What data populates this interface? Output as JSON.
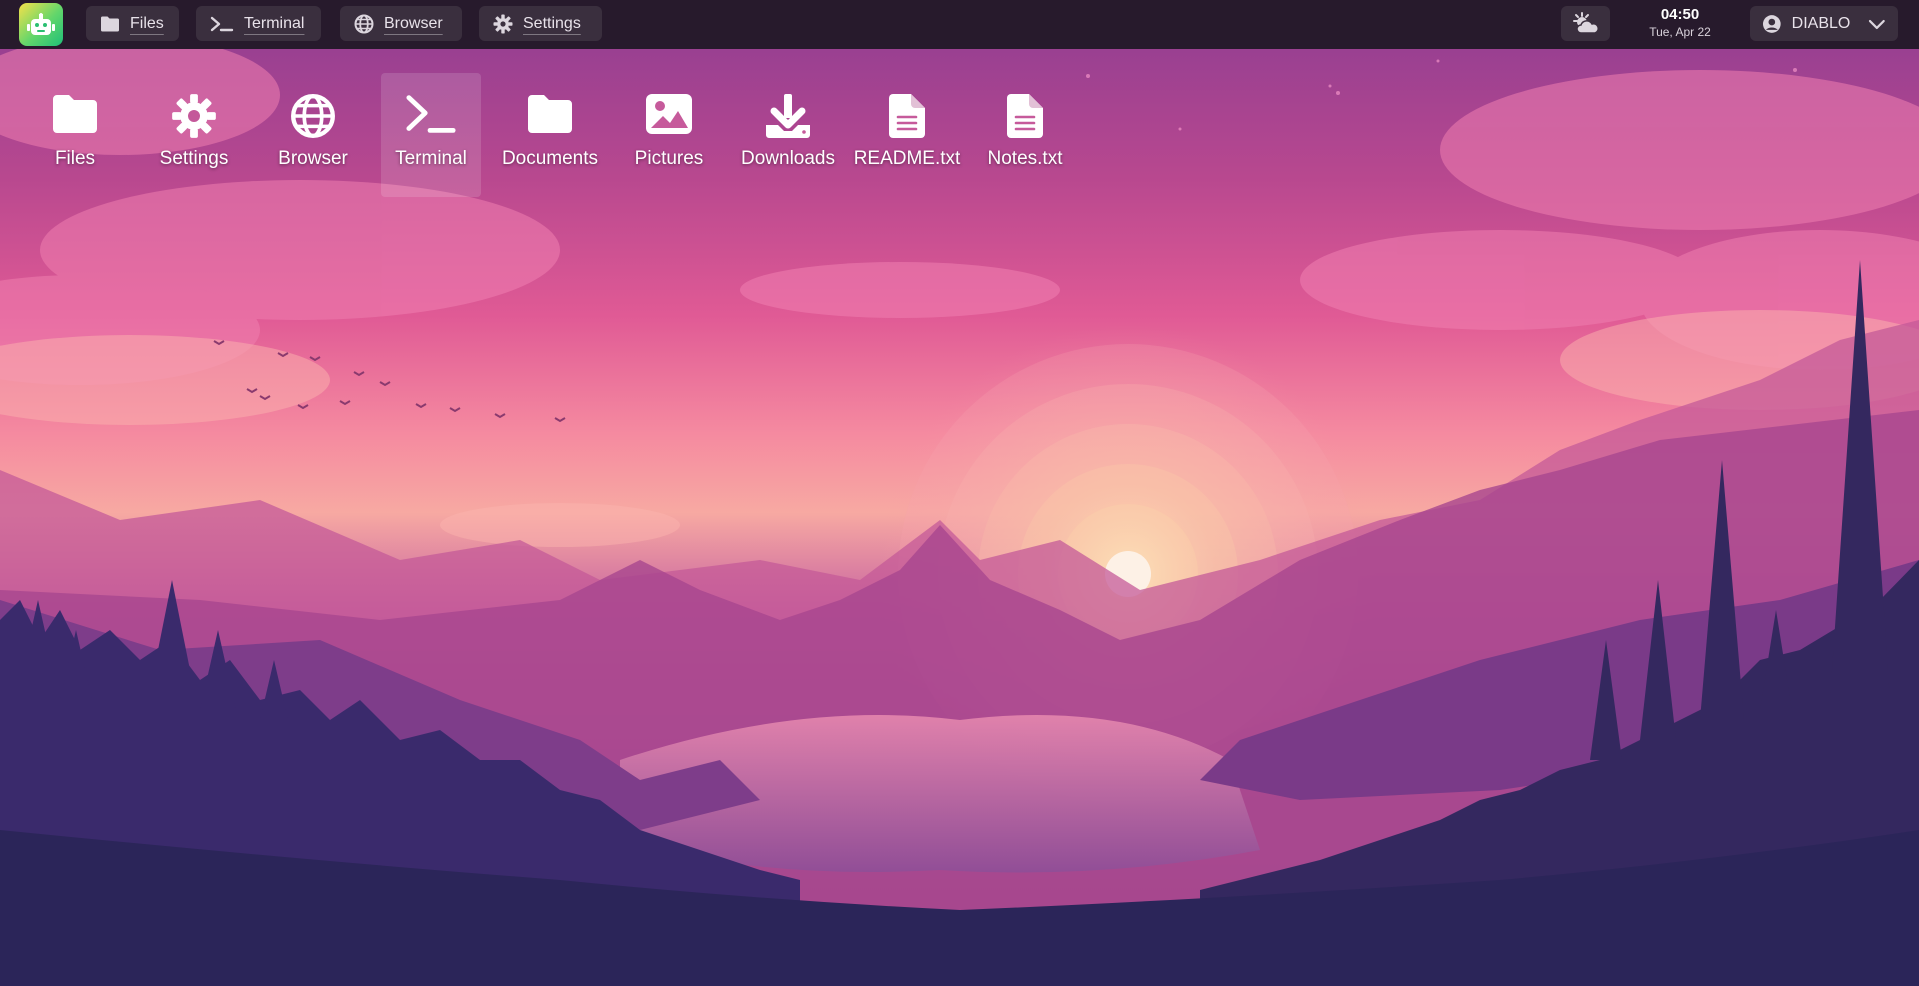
{
  "topbar": {
    "logo_icon": "robot-icon",
    "buttons": [
      {
        "label": "Files",
        "icon": "folder-icon"
      },
      {
        "label": "Terminal",
        "icon": "terminal-icon"
      },
      {
        "label": "Browser",
        "icon": "globe-icon"
      },
      {
        "label": "Settings",
        "icon": "gear-icon"
      }
    ],
    "weather_icon": "sun-cloud-icon",
    "clock": {
      "time": "04:50",
      "date": "Tue, Apr 22"
    },
    "user": {
      "name": "DIABLO",
      "icon": "user-circle-icon",
      "menu_icon": "chevron-down-icon"
    }
  },
  "desktop": {
    "icons": [
      {
        "label": "Files",
        "icon": "folder-icon"
      },
      {
        "label": "Settings",
        "icon": "gear-icon"
      },
      {
        "label": "Browser",
        "icon": "globe-icon"
      },
      {
        "label": "Terminal",
        "icon": "terminal-icon",
        "selected": true
      },
      {
        "label": "Documents",
        "icon": "folder-icon"
      },
      {
        "label": "Pictures",
        "icon": "image-icon"
      },
      {
        "label": "Downloads",
        "icon": "download-icon"
      },
      {
        "label": "README.txt",
        "icon": "file-text-icon"
      },
      {
        "label": "Notes.txt",
        "icon": "file-text-icon"
      }
    ]
  },
  "colors": {
    "topbar_bg": "#271a2c",
    "button_bg": "#3a2f3e",
    "sky_top": "#8e3d92",
    "sky_mid": "#e05a95",
    "horizon": "#f7a9a2",
    "sun": "#fbe6c8",
    "ground": "#2e2660"
  },
  "wallpaper": {
    "description_icon": "mountain-lake-sunset-wallpaper"
  }
}
